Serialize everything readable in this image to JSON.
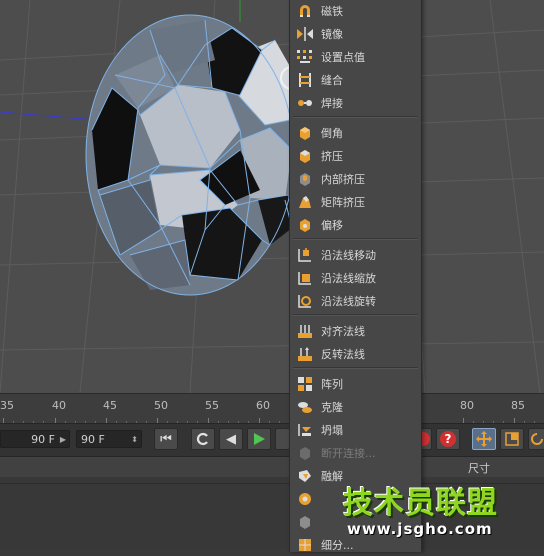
{
  "menu": {
    "items": [
      {
        "label": "磁铁",
        "icon": "magnet-icon",
        "disabled": false
      },
      {
        "label": "镜像",
        "icon": "mirror-icon",
        "disabled": false
      },
      {
        "label": "设置点值",
        "icon": "set-point-value-icon",
        "disabled": false
      },
      {
        "label": "缝合",
        "icon": "stitch-icon",
        "disabled": false
      },
      {
        "label": "焊接",
        "icon": "weld-icon",
        "disabled": false
      },
      {
        "label": "倒角",
        "icon": "bevel-icon",
        "disabled": false
      },
      {
        "label": "挤压",
        "icon": "extrude-icon",
        "disabled": false
      },
      {
        "label": "内部挤压",
        "icon": "extrude-inner-icon",
        "disabled": false
      },
      {
        "label": "矩阵挤压",
        "icon": "matrix-extrude-icon",
        "disabled": false
      },
      {
        "label": "偏移",
        "icon": "offset-icon",
        "disabled": false
      },
      {
        "label": "沿法线移动",
        "icon": "normal-move-icon",
        "disabled": false
      },
      {
        "label": "沿法线缩放",
        "icon": "normal-scale-icon",
        "disabled": false
      },
      {
        "label": "沿法线旋转",
        "icon": "normal-rotate-icon",
        "disabled": false
      },
      {
        "label": "对齐法线",
        "icon": "align-normals-icon",
        "disabled": false
      },
      {
        "label": "反转法线",
        "icon": "reverse-normals-icon",
        "disabled": false
      },
      {
        "label": "阵列",
        "icon": "array-icon",
        "disabled": false
      },
      {
        "label": "克隆",
        "icon": "clone-icon",
        "disabled": false
      },
      {
        "label": "坍塌",
        "icon": "collapse-icon",
        "disabled": false
      },
      {
        "label": "断开连接...",
        "icon": "disconnect-icon",
        "disabled": true
      },
      {
        "label": "融解",
        "icon": "melt-icon",
        "disabled": false
      },
      {
        "label": "",
        "icon": "optimize-icon",
        "disabled": false
      },
      {
        "label": "",
        "icon": "split-icon",
        "disabled": false
      },
      {
        "label": "细分...",
        "icon": "subdivide-icon",
        "disabled": false
      }
    ]
  },
  "timeline": {
    "ticks": [
      "35",
      "40",
      "45",
      "50",
      "55",
      "60",
      "80",
      "85"
    ]
  },
  "transport": {
    "start_frame": "90 F",
    "end_frame": "90 F"
  },
  "attributes": {
    "column_header": "尺寸"
  },
  "watermark": {
    "title": "技术员联盟",
    "url": "www.jsgho.com"
  },
  "colors": {
    "accent_orange": "#e8a032",
    "play_green": "#52c452",
    "record_red": "#d23030",
    "menu_bg": "#474747",
    "mesh_wire": "#7fb2e6"
  }
}
